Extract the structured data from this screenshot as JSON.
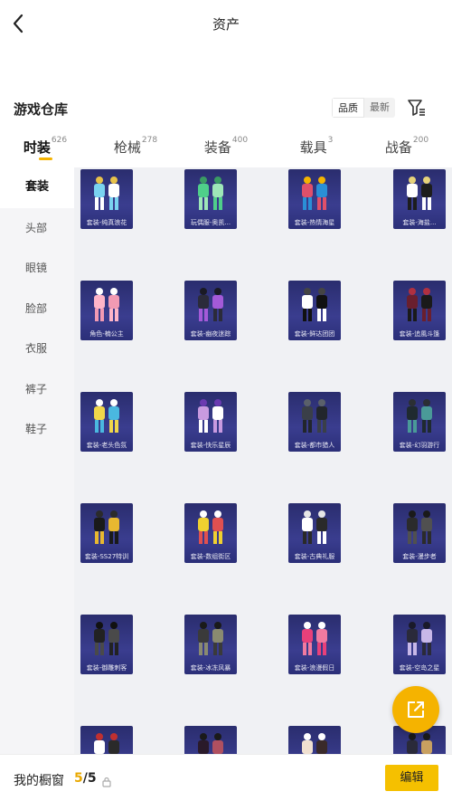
{
  "header": {
    "title": "资产"
  },
  "section": {
    "title": "游戏仓库",
    "sort_options": [
      "品质",
      "最新"
    ],
    "active_sort": 0
  },
  "tabs": [
    {
      "label": "时装",
      "count": "626",
      "active": true
    },
    {
      "label": "枪械",
      "count": "278",
      "active": false
    },
    {
      "label": "装备",
      "count": "400",
      "active": false
    },
    {
      "label": "载具",
      "count": "3",
      "active": false
    },
    {
      "label": "战备",
      "count": "200",
      "active": false
    }
  ],
  "sidebar": {
    "items": [
      {
        "label": "套装",
        "active": true
      },
      {
        "label": "头部",
        "active": false
      },
      {
        "label": "眼镜",
        "active": false
      },
      {
        "label": "脸部",
        "active": false
      },
      {
        "label": "衣服",
        "active": false
      },
      {
        "label": "裤子",
        "active": false
      },
      {
        "label": "鞋子",
        "active": false
      }
    ]
  },
  "items": [
    {
      "label": "套装-纯真浪花",
      "colors": [
        "#7ad3f0",
        "#ffffff",
        "#e8c24a"
      ]
    },
    {
      "label": "玩偶服-奥凯...",
      "colors": [
        "#4fcf8a",
        "#9ee7b8",
        "#3a9b64"
      ]
    },
    {
      "label": "套装-热情海星",
      "colors": [
        "#e0506a",
        "#2a8fd6",
        "#f4b400"
      ]
    },
    {
      "label": "套装-海盐...",
      "colors": [
        "#ffffff",
        "#1d1d1d",
        "#e6d27a"
      ]
    },
    {
      "label": "角色-楠公主",
      "colors": [
        "#ffb5c8",
        "#f29ab3",
        "#ffffff"
      ]
    },
    {
      "label": "套装-幽夜迷踪",
      "colors": [
        "#2b2b3a",
        "#a45ad8",
        "#1a1a24"
      ]
    },
    {
      "label": "套装-鲜达团团",
      "colors": [
        "#ffffff",
        "#111111",
        "#444444"
      ]
    },
    {
      "label": "套装-追風斗篷",
      "colors": [
        "#6a1f2e",
        "#1a1a1a",
        "#b03040"
      ]
    },
    {
      "label": "套装-老头色氛",
      "colors": [
        "#f0d64a",
        "#4ab8e0",
        "#ffffff"
      ]
    },
    {
      "label": "套装-快乐星辰",
      "colors": [
        "#c89ae0",
        "#ffffff",
        "#6a3ab0"
      ]
    },
    {
      "label": "套装-都市猎人",
      "colors": [
        "#3a3f48",
        "#22262c",
        "#5a606a"
      ]
    },
    {
      "label": "套装-幻羽游行",
      "colors": [
        "#1f2a30",
        "#4a9a98",
        "#2b2f34"
      ]
    },
    {
      "label": "套装-SS27特训",
      "colors": [
        "#1a1a1a",
        "#e8b830",
        "#2b2b2b"
      ]
    },
    {
      "label": "套装-数组街区",
      "colors": [
        "#f0d030",
        "#e05050",
        "#ffffff"
      ]
    },
    {
      "label": "套装-古典礼服",
      "colors": [
        "#ffffff",
        "#2a2a2a",
        "#e6e6e6"
      ]
    },
    {
      "label": "套装-漫步者",
      "colors": [
        "#2b2b2b",
        "#505050",
        "#1a1a1a"
      ]
    },
    {
      "label": "套装-御雕刺客",
      "colors": [
        "#222222",
        "#4a4a4a",
        "#111111"
      ]
    },
    {
      "label": "套装-冰冻风暴",
      "colors": [
        "#3a3a3a",
        "#8a8a70",
        "#1a1a1a"
      ]
    },
    {
      "label": "套装-浪漫假日",
      "colors": [
        "#e8407a",
        "#f07aa0",
        "#ffffff"
      ]
    },
    {
      "label": "套装-空岛之星",
      "colors": [
        "#2a2a3a",
        "#c8b8e8",
        "#1a1a2a"
      ]
    },
    {
      "label": "",
      "colors": [
        "#ffffff",
        "#2a2a2a",
        "#c03030"
      ]
    },
    {
      "label": "",
      "colors": [
        "#2a1a2a",
        "#b05060",
        "#1a1a1a"
      ]
    },
    {
      "label": "",
      "colors": [
        "#f0e0d0",
        "#3a2a2a",
        "#ffffff"
      ]
    },
    {
      "label": "",
      "colors": [
        "#2a2a3a",
        "#c8a060",
        "#1a1a1a"
      ]
    }
  ],
  "showcase": {
    "label": "我的橱窗",
    "current": "5",
    "separator": "/",
    "total": "5"
  },
  "edit_button": {
    "label": "编辑"
  },
  "theme": {
    "accent": "#f5b300",
    "card_bg": "#2f3380"
  }
}
